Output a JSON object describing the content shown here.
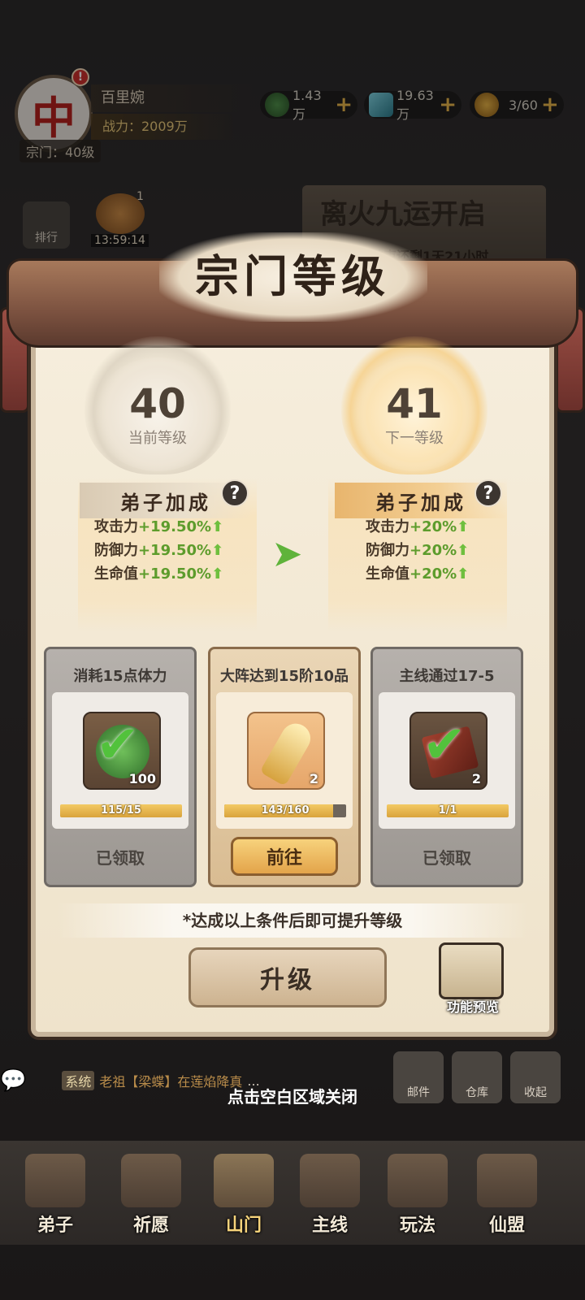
{
  "top_bar": {
    "player_name": "百里婉",
    "power": "战力：2009万",
    "sect_level": "宗门：40级",
    "resources": [
      {
        "value": "1.43万",
        "icon": "jade-coin-icon"
      },
      {
        "value": "19.63万",
        "icon": "crystal-icon"
      },
      {
        "value": "3/60",
        "icon": "stamina-gourd-icon"
      }
    ]
  },
  "side": {
    "rank_label": "排行",
    "timer": "13:59:14",
    "gift_badge": "1"
  },
  "event": {
    "title": "离火九运开启",
    "subtitle": "结束还剩1天21小时"
  },
  "modal": {
    "title": "宗门等级",
    "current": {
      "level": "40",
      "label": "当前等级"
    },
    "next": {
      "level": "41",
      "label": "下一等级"
    },
    "bonus_title": "弟子加成",
    "current_stats": [
      {
        "name": "攻击力",
        "value": "+19.50%"
      },
      {
        "name": "防御力",
        "value": "+19.50%"
      },
      {
        "name": "生命值",
        "value": "+19.50%"
      }
    ],
    "next_stats": [
      {
        "name": "攻击力",
        "value": "+20%"
      },
      {
        "name": "防御力",
        "value": "+20%"
      },
      {
        "name": "生命值",
        "value": "+20%"
      }
    ],
    "conditions": [
      {
        "title": "消耗15点体力",
        "count": "100",
        "progress_text": "115/15",
        "progress": 1.0,
        "status": "已领取",
        "icon": "jade-orb-icon"
      },
      {
        "title": "大阵达到15阶10品",
        "count": "2",
        "progress_text": "143/160",
        "progress": 0.894,
        "button": "前往",
        "icon": "golden-key-icon"
      },
      {
        "title": "主线通过17-5",
        "count": "2",
        "progress_text": "1/1",
        "progress": 1.0,
        "status": "已领取",
        "icon": "red-scroll-icon"
      }
    ],
    "note": "*达成以上条件后即可提升等级",
    "upgrade_label": "升级",
    "preview_label": "功能预览"
  },
  "chat": {
    "tag": "系统",
    "text": "老祖【梁蝶】在莲焰降真",
    "ellipsis": "..."
  },
  "close_hint": "点击空白区域关闭",
  "utilities": [
    "邮件",
    "仓库",
    "收起"
  ],
  "nav": [
    "弟子",
    "祈愿",
    "山门",
    "主线",
    "玩法",
    "仙盟"
  ]
}
